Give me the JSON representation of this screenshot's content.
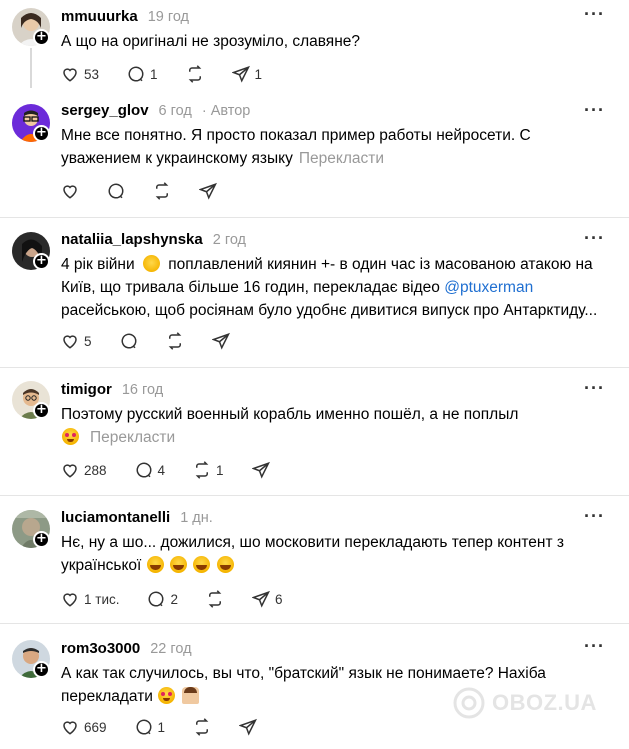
{
  "posts": [
    {
      "username": "mmuuurka",
      "time": "19 год",
      "author_tag": "",
      "text": "А що на оригіналі не зрозуміло, славяне?",
      "translate": "",
      "likes": "53",
      "replies": "1",
      "reposts": "",
      "shares": "1"
    },
    {
      "username": "sergey_glov",
      "time": "6 год",
      "author_tag": "Автор",
      "text": "Мне все понятно. Я просто показал пример работы нейросети. С уважением к украинскому языку",
      "translate": "Перекласти",
      "likes": "",
      "replies": "",
      "reposts": "",
      "shares": ""
    },
    {
      "username": "nataliia_lapshynska",
      "time": "2 год",
      "author_tag": "",
      "text_part1": "4 рік війни",
      "text_part2": "поплавлений киянин +- в один час із масованою атакою на Київ, що тривала більше 16 годин, перекладає відео",
      "mention": "@ptuxerman",
      "text_part3": "расейською, щоб росіянам було удобнє дивитися випуск про Антарктиду...",
      "likes": "5",
      "replies": "",
      "reposts": "",
      "shares": ""
    },
    {
      "username": "timigor",
      "time": "16 год",
      "author_tag": "",
      "text": "Поэтому русский военный корабль именно пошёл, а не поплыл",
      "translate": "Перекласти",
      "likes": "288",
      "replies": "4",
      "reposts": "1",
      "shares": ""
    },
    {
      "username": "luciamontanelli",
      "time": "1 дн.",
      "author_tag": "",
      "text": "Нє, ну а шо... дожилися, шо московити перекладають тепер контент з української",
      "likes": "1 тис.",
      "replies": "2",
      "reposts": "",
      "shares": "6"
    },
    {
      "username": "rom3o3000",
      "time": "22 год",
      "author_tag": "",
      "text": "А как так случилось, вы что, \"братский\" язык не понимаете? Нахіба перекладати",
      "likes": "669",
      "replies": "1",
      "reposts": "",
      "shares": ""
    }
  ],
  "more_label": "···",
  "watermark": "OBOZ.UA",
  "colors": {
    "text": "#000000",
    "muted": "#999999",
    "mention": "#1f6fd1",
    "divider": "#e5e5e5"
  }
}
